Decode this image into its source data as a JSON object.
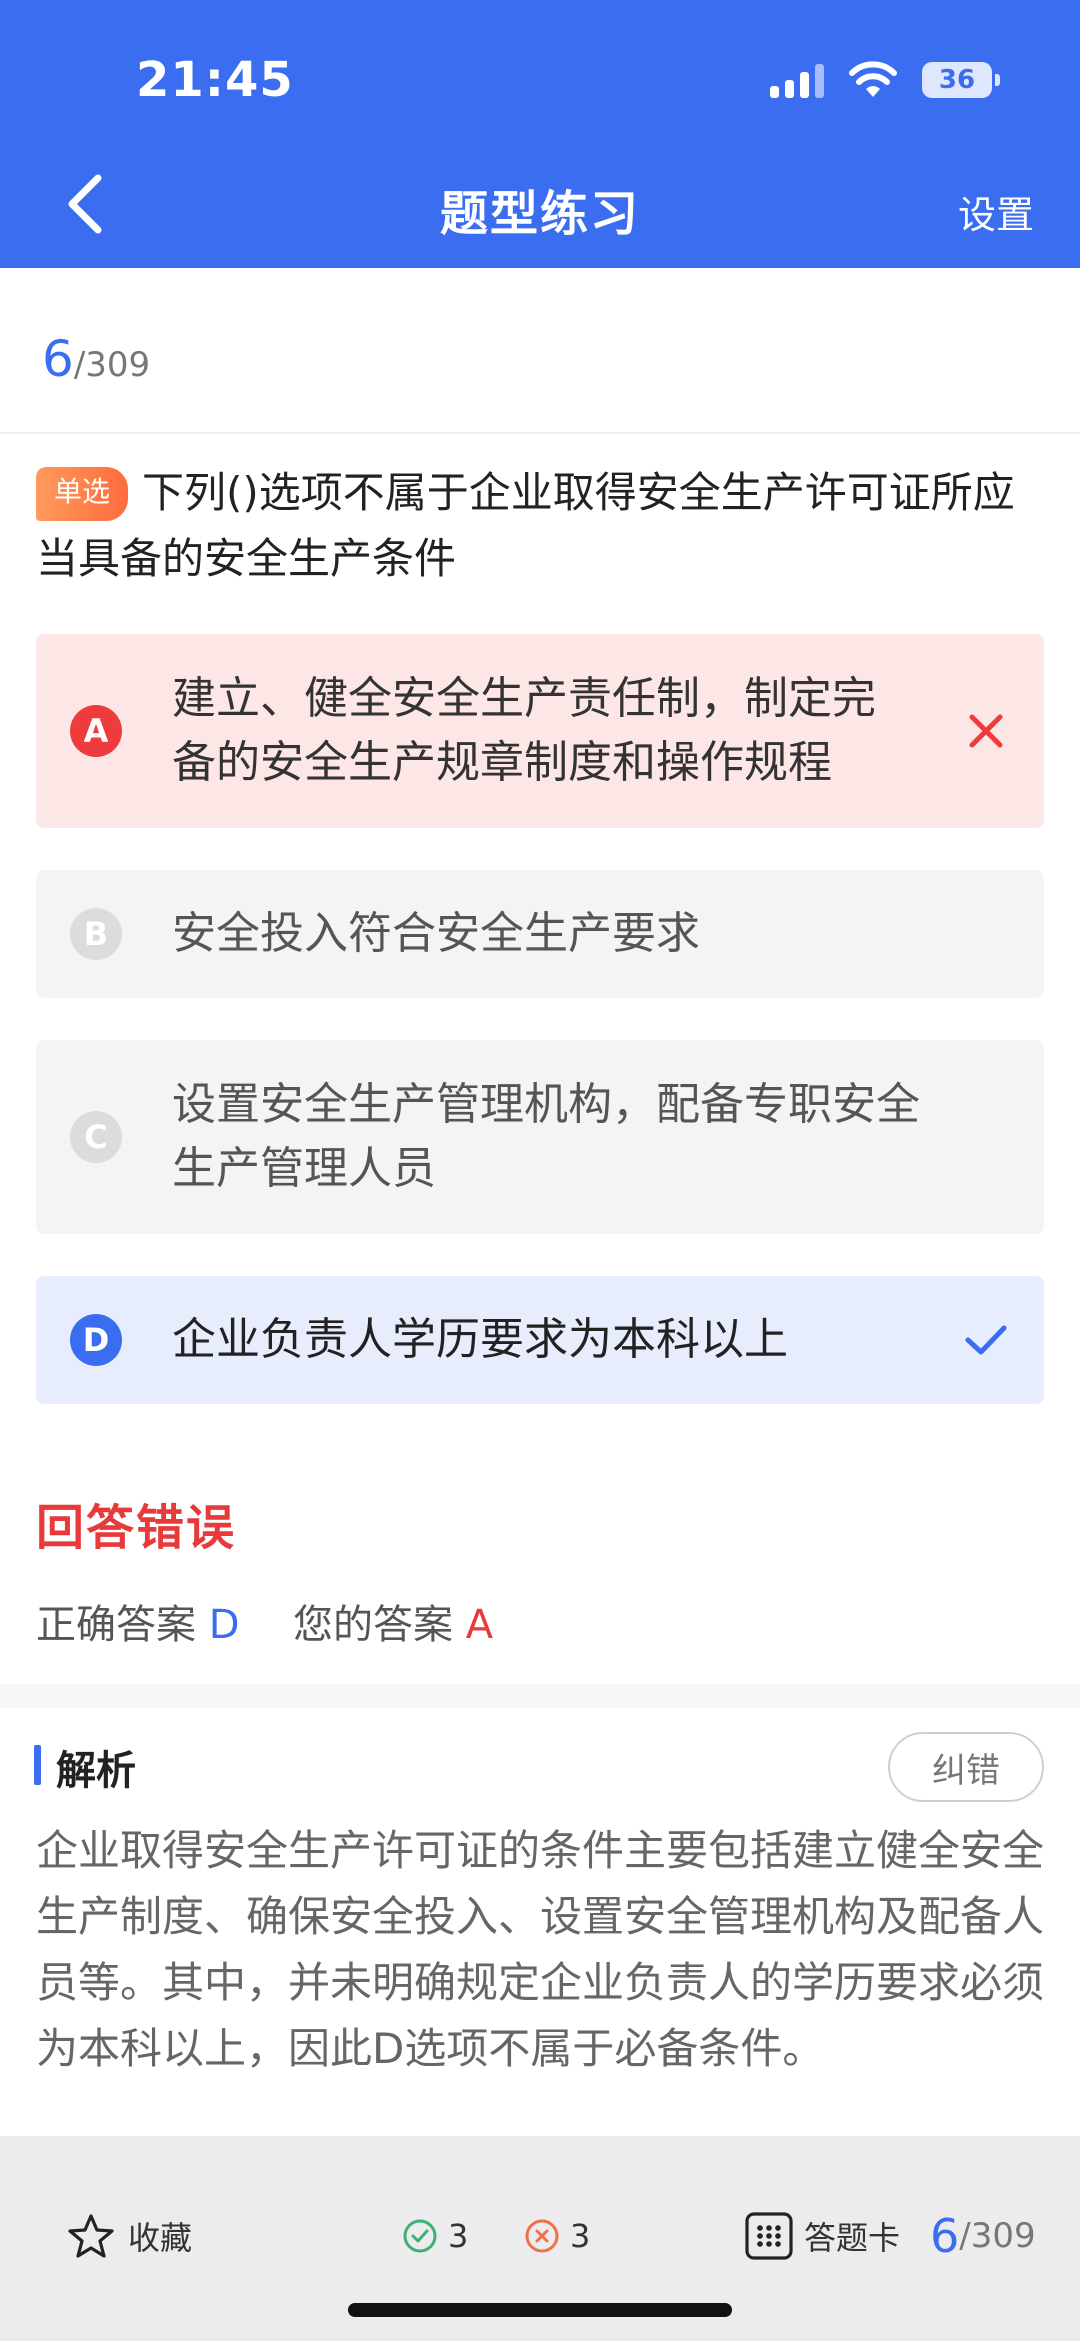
{
  "status_bar": {
    "time": "21:45",
    "battery": "36"
  },
  "nav": {
    "title": "题型练习",
    "settings_label": "设置"
  },
  "progress": {
    "current": "6",
    "total": "/309"
  },
  "question": {
    "type_tag": "单选",
    "text": "下列()选项不属于企业取得安全生产许可证所应当具备的安全生产条件"
  },
  "options": [
    {
      "letter": "A",
      "text": "建立、健全安全生产责任制，制定完备的安全生产规章制度和操作规程",
      "state": "wrong"
    },
    {
      "letter": "B",
      "text": "安全投入符合安全生产要求",
      "state": "neutral"
    },
    {
      "letter": "C",
      "text": "设置安全生产管理机构，配备专职安全生产管理人员",
      "state": "neutral"
    },
    {
      "letter": "D",
      "text": "企业负责人学历要求为本科以上",
      "state": "correct"
    }
  ],
  "result": {
    "title": "回答错误",
    "correct_label": "正确答案",
    "correct_value": "D",
    "your_label": "您的答案",
    "your_value": "A"
  },
  "analysis": {
    "title": "解析",
    "correct_button": "纠错",
    "text": "企业取得安全生产许可证的条件主要包括建立健全安全生产制度、确保安全投入、设置安全管理机构及配备人员等。其中，并未明确规定企业负责人的学历要求必须为本科以上，因此D选项不属于必备条件。"
  },
  "bottom_bar": {
    "favorite_label": "收藏",
    "right_count": "3",
    "wrong_count": "3",
    "answer_card_label": "答题卡",
    "progress_current": "6",
    "progress_total": "/309"
  },
  "colors": {
    "brand": "#3a6df0",
    "error": "#e83a3a",
    "wrong_bg": "#fde6e6",
    "correct_bg": "#e7edfd",
    "neutral_bg": "#f4f4f5"
  }
}
